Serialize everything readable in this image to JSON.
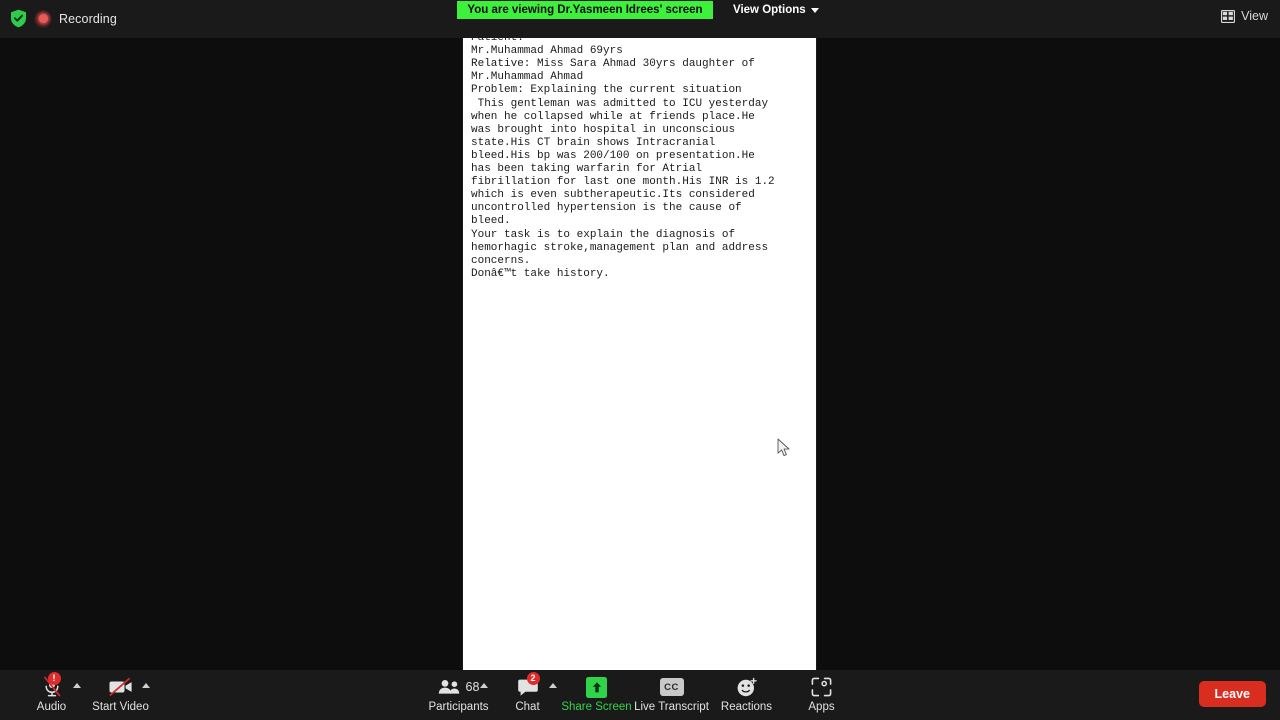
{
  "topbar": {
    "shield_icon": "shield-check-icon",
    "recording_icon": "recording-dot-icon",
    "recording_label": "Recording",
    "viewing_banner": "You are viewing Dr.Yasmeen Idrees' screen",
    "view_options_label": "View Options",
    "view_options_icon": "chevron-down-icon",
    "view_label": "View",
    "view_icon": "grid-layout-icon",
    "banner_color": "#3cf03c"
  },
  "shared_screen": {
    "document_text": "You are a dr in the ICU.\nPatient:\nMr.Muhammad Ahmad 69yrs\nRelative: Miss Sara Ahmad 30yrs daughter of\nMr.Muhammad Ahmad\nProblem: Explaining the current situation\n This gentleman was admitted to ICU yesterday\nwhen he collapsed while at friends place.He\nwas brought into hospital in unconscious\nstate.His CT brain shows Intracranial\nbleed.His bp was 200/100 on presentation.He\nhas been taking warfarin for Atrial\nfibrillation for last one month.His INR is 1.2\nwhich is even subtherapeutic.Its considered\nuncontrolled hypertension is the cause of\nbleed.\nYour task is to explain the diagnosis of\nhemorhagic stroke,management plan and address\nconcerns.\nDonâ€™t take history.",
    "cursor_icon": "mouse-pointer-icon"
  },
  "toolbar": {
    "audio": {
      "label": "Audio",
      "icon": "microphone-muted-icon",
      "badge": "!",
      "caret_icon": "caret-up-icon"
    },
    "video": {
      "label": "Start Video",
      "icon": "camera-off-icon",
      "caret_icon": "caret-up-icon"
    },
    "participants": {
      "label": "Participants",
      "icon": "people-icon",
      "count": "68",
      "caret_icon": "caret-up-icon"
    },
    "chat": {
      "label": "Chat",
      "icon": "chat-bubble-icon",
      "badge": "2",
      "caret_icon": "caret-up-icon"
    },
    "share_screen": {
      "label": "Share Screen",
      "icon": "share-screen-up-arrow-icon",
      "color": "#35d24b"
    },
    "live_transcript": {
      "label": "Live Transcript",
      "icon": "closed-caption-icon",
      "icon_text": "CC"
    },
    "reactions": {
      "label": "Reactions",
      "icon": "smiley-plus-icon"
    },
    "apps": {
      "label": "Apps",
      "icon": "apps-bracket-icon"
    },
    "leave": {
      "label": "Leave",
      "color": "#d92d20"
    }
  }
}
